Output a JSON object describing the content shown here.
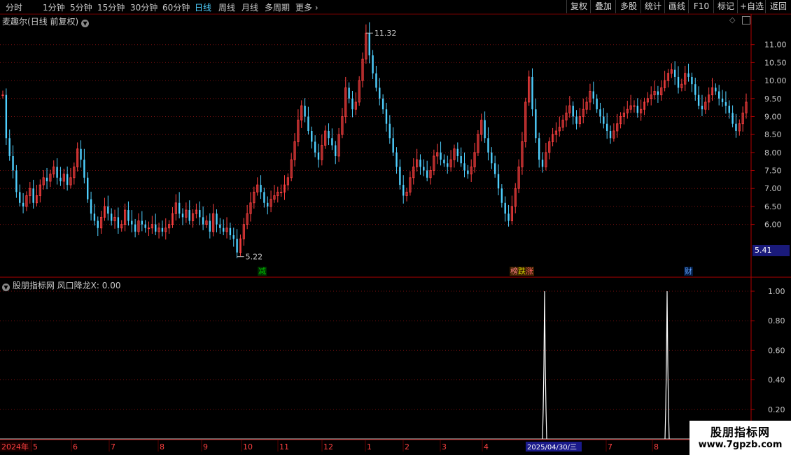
{
  "toolbar": {
    "periods": [
      "分时",
      "1分钟",
      "5分钟",
      "15分钟",
      "30分钟",
      "60分钟",
      "日线",
      "周线",
      "月线",
      "多周期",
      "更多"
    ],
    "active_period": "日线",
    "right_buttons": [
      "复权",
      "叠加",
      "多股",
      "统计",
      "画线",
      "F10",
      "标记",
      "+自选",
      "返回"
    ]
  },
  "chart_title": {
    "stock": "麦趣尔",
    "mode": "(日线 前复权)"
  },
  "indicator_title": {
    "name": "股朋指标网",
    "formula": "风口降龙X: 0.00"
  },
  "price_axis_labels": [
    "11.00",
    "10.50",
    "10.00",
    "9.50",
    "9.00",
    "8.50",
    "8.00",
    "7.50",
    "7.00",
    "6.50",
    "6.00"
  ],
  "indicator_axis_labels": [
    "1.00",
    "0.80",
    "0.60",
    "0.40",
    "0.20"
  ],
  "current_price": "5.41",
  "high_marker": "11.32",
  "low_marker": "5.22",
  "events": [
    {
      "label": "减",
      "color": "#00c000"
    },
    {
      "label": "榜",
      "color": "#ff8080"
    },
    {
      "label": "跌",
      "color": "#d0d000"
    },
    {
      "label": "涨",
      "color": "#ff6060"
    },
    {
      "label": "财",
      "color": "#60a0ff"
    }
  ],
  "date_axis": {
    "year_label": "2024年",
    "months": [
      "5",
      "6",
      "7",
      "8",
      "9",
      "10",
      "11",
      "12",
      "1",
      "2",
      "3",
      "4",
      "7",
      "8"
    ],
    "cursor_date": "2025/04/30/三"
  },
  "watermark": {
    "line1": "股朋指标网",
    "line2": "www.7gpzb.com"
  },
  "colors": {
    "up": "#ff4040",
    "down": "#4fd0ff",
    "grid": "#7a1010",
    "axis": "#b00000",
    "signal": "#ffffff"
  },
  "chart_data": {
    "type": "candlestick",
    "closes": [
      9.6,
      8.4,
      7.9,
      7.5,
      6.9,
      6.6,
      6.5,
      6.8,
      7.0,
      6.6,
      6.8,
      7.1,
      7.3,
      7.2,
      7.4,
      7.6,
      7.3,
      7.2,
      7.4,
      7.1,
      7.3,
      7.6,
      8.1,
      7.8,
      7.3,
      6.7,
      6.3,
      6.1,
      5.9,
      6.2,
      6.5,
      6.3,
      6.1,
      6.2,
      5.9,
      6.0,
      6.4,
      6.1,
      6.0,
      5.8,
      6.1,
      6.0,
      5.9,
      5.9,
      6.0,
      5.8,
      5.9,
      5.8,
      5.9,
      6.0,
      6.3,
      6.6,
      6.3,
      6.2,
      6.4,
      6.1,
      6.3,
      6.4,
      6.2,
      6.0,
      6.1,
      5.8,
      6.3,
      6.0,
      5.9,
      5.8,
      5.9,
      5.7,
      5.6,
      5.22,
      5.6,
      6.0,
      6.3,
      6.6,
      6.9,
      7.1,
      6.9,
      6.6,
      6.5,
      6.7,
      6.8,
      6.9,
      6.9,
      7.1,
      7.3,
      7.8,
      8.3,
      8.9,
      9.3,
      9.0,
      8.6,
      8.3,
      8.0,
      7.8,
      8.2,
      8.6,
      8.4,
      8.2,
      7.9,
      8.5,
      9.0,
      9.8,
      9.5,
      9.2,
      9.4,
      10.0,
      10.6,
      11.32,
      10.7,
      10.2,
      9.8,
      9.5,
      9.2,
      8.8,
      8.4,
      8.0,
      7.6,
      7.1,
      6.8,
      6.9,
      7.3,
      7.6,
      7.8,
      7.6,
      7.5,
      7.3,
      7.5,
      7.9,
      8.0,
      7.8,
      7.7,
      7.6,
      7.8,
      8.1,
      7.9,
      7.7,
      7.5,
      7.4,
      7.6,
      8.0,
      8.5,
      8.9,
      8.4,
      8.0,
      7.7,
      7.4,
      7.0,
      6.6,
      6.3,
      6.1,
      6.5,
      7.0,
      7.6,
      8.3,
      9.4,
      10.1,
      9.2,
      8.4,
      7.8,
      7.6,
      8.0,
      8.3,
      8.5,
      8.6,
      8.7,
      8.9,
      9.1,
      9.3,
      9.0,
      8.8,
      9.0,
      9.2,
      9.4,
      9.7,
      9.5,
      9.2,
      9.0,
      8.8,
      8.6,
      8.4,
      8.6,
      8.8,
      9.0,
      9.1,
      9.2,
      9.3,
      9.3,
      9.1,
      9.2,
      9.4,
      9.5,
      9.6,
      9.7,
      9.6,
      9.8,
      10.0,
      10.2,
      10.3,
      10.1,
      9.8,
      9.9,
      10.2,
      10.1,
      9.9,
      9.6,
      9.3,
      9.2,
      9.4,
      9.6,
      9.8,
      9.7,
      9.5,
      9.4,
      9.3,
      9.1,
      8.8,
      8.6,
      8.8,
      9.1,
      9.4
    ],
    "price_range": [
      5.0,
      11.5
    ],
    "signal": {
      "range": [
        0,
        1.0
      ],
      "spikes_at_date": [
        "2025/04/30/三",
        "8"
      ]
    }
  }
}
